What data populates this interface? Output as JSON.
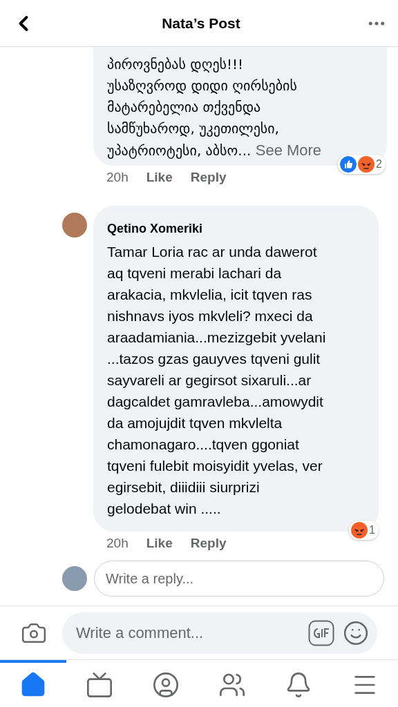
{
  "header": {
    "title": "Nata’s Post"
  },
  "comments": [
    {
      "text": "პიროვნებას დღეს!!!\nუსაზღვროდ დიდი ღირსების\nმატარებელია თქვენდა\nსამწუხაროდ, უკეთილესი,\nუპატრიოტესი, აბსო...",
      "see_more": "See More",
      "time": "20h",
      "like": "Like",
      "reply": "Reply",
      "reactions": [
        {
          "kind": "like"
        },
        {
          "kind": "angry"
        }
      ],
      "reaction_count": "2"
    },
    {
      "author": "Qetino Xomeriki",
      "text": "Tamar Loria rac ar unda dawerot\naq tqveni merabi lachari da\narakacia, mkvlelia, icit tqven ras\nnishnavs iyos mkvleli? mxeci da\naraadamiania...mezizgebit yvelani\n...tazos gzas gauyves tqveni gulit\nsayvareli ar gegirsot sixaruli...ar\ndagcaldet gamravleba...amowydit\nda amojujdit tqven mkvlelta\nchamonagaro....tqven ggoniat\ntqveni fulebit moisyidit yvelas, ver\negirsebit, diiidiii siurprizi\ngelodebat win .....",
      "time": "20h",
      "like": "Like",
      "reply": "Reply",
      "reactions": [
        {
          "kind": "angry"
        }
      ],
      "reaction_count": "1"
    }
  ],
  "reply_field": {
    "placeholder": "Write a reply..."
  },
  "comment_field": {
    "placeholder": "Write a comment..."
  },
  "tabs": [
    {
      "kind": "home",
      "selected": true
    },
    {
      "kind": "video",
      "selected": false
    },
    {
      "kind": "profile",
      "selected": false
    },
    {
      "kind": "groups",
      "selected": false
    },
    {
      "kind": "notifications",
      "selected": false
    },
    {
      "kind": "menu",
      "selected": false
    }
  ]
}
